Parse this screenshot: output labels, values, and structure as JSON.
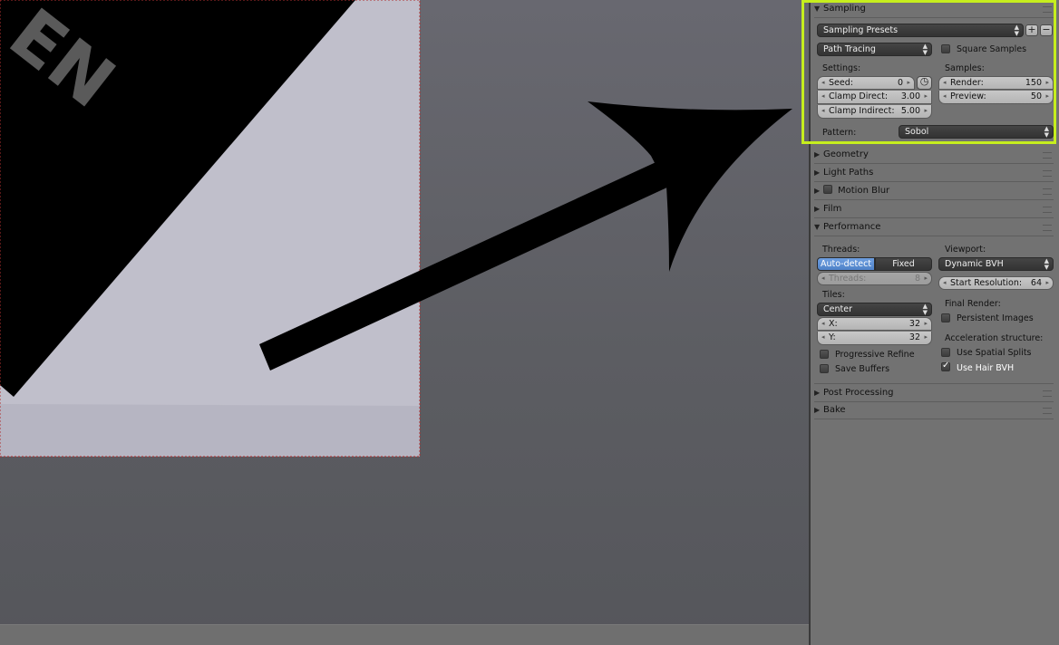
{
  "viewport": {
    "render_text": "EN",
    "arrow_icon": "arrow-icon"
  },
  "sampling": {
    "header": "Sampling",
    "presets": "Sampling Presets",
    "integrator": "Path Tracing",
    "square_samples_label": "Square Samples",
    "square_samples_checked": false,
    "settings_label": "Settings:",
    "samples_label": "Samples:",
    "seed_label": "Seed:",
    "seed_value": "0",
    "clamp_direct_label": "Clamp Direct:",
    "clamp_direct_value": "3.00",
    "clamp_indirect_label": "Clamp Indirect:",
    "clamp_indirect_value": "5.00",
    "render_label": "Render:",
    "render_value": "150",
    "preview_label": "Preview:",
    "preview_value": "50",
    "pattern_label": "Pattern:",
    "pattern_value": "Sobol"
  },
  "sections": {
    "geometry": "Geometry",
    "light_paths": "Light Paths",
    "motion_blur": "Motion Blur",
    "film": "Film",
    "performance": "Performance",
    "post_processing": "Post Processing",
    "bake": "Bake"
  },
  "performance": {
    "threads_label": "Threads:",
    "auto_detect": "Auto-detect",
    "fixed": "Fixed",
    "threads_field_label": "Threads:",
    "threads_field_value": "8",
    "tiles_label": "Tiles:",
    "tiles_order": "Center",
    "x_label": "X:",
    "x_value": "32",
    "y_label": "Y:",
    "y_value": "32",
    "progressive_refine": "Progressive Refine",
    "save_buffers": "Save Buffers",
    "viewport_label": "Viewport:",
    "viewport_bvh": "Dynamic BVH",
    "start_resolution_label": "Start Resolution:",
    "start_resolution_value": "64",
    "final_render_label": "Final Render:",
    "persistent_images": "Persistent Images",
    "accel_label": "Acceleration structure:",
    "use_spatial_splits": "Use Spatial Splits",
    "use_hair_bvh": "Use Hair BVH",
    "use_hair_bvh_checked": true
  },
  "colors": {
    "highlight": "#c6ee1e",
    "active_button": "#5b8fd6"
  }
}
